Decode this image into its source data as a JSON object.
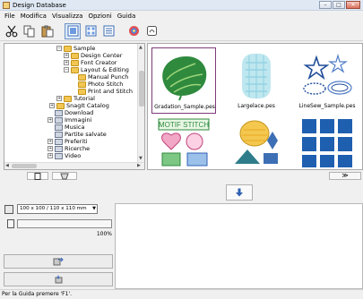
{
  "window": {
    "title": "Design Database"
  },
  "menu": [
    "File",
    "Modifica",
    "Visualizza",
    "Opzioni",
    "Guida"
  ],
  "toolbar": {
    "icons": [
      "cut-icon",
      "copy-icon",
      "paste-icon",
      "large-icons-view-icon",
      "medium-icons-view-icon",
      "small-icons-view-icon",
      "detail-view-icon",
      "property-icon"
    ]
  },
  "tree": {
    "items": [
      {
        "label": "Sample",
        "level": 3,
        "expander": "−"
      },
      {
        "label": "Design Center",
        "level": 4,
        "expander": "+"
      },
      {
        "label": "Font Creator",
        "level": 4,
        "expander": "+"
      },
      {
        "label": "Layout & Editing",
        "level": 4,
        "expander": "−"
      },
      {
        "label": "Manual Punch",
        "level": 5,
        "expander": ""
      },
      {
        "label": "Photo Stitch",
        "level": 5,
        "expander": ""
      },
      {
        "label": "Print and Stitch",
        "level": 5,
        "expander": ""
      },
      {
        "label": "Tutorial",
        "level": 3,
        "expander": "+"
      },
      {
        "label": "SnagIt Catalog",
        "level": 2,
        "expander": "+"
      },
      {
        "label": "Download",
        "level": 1,
        "expander": ""
      },
      {
        "label": "Immagini",
        "level": 1,
        "expander": "+"
      },
      {
        "label": "Musica",
        "level": 1,
        "expander": ""
      },
      {
        "label": "Partite salvate",
        "level": 1,
        "expander": ""
      },
      {
        "label": "Preferiti",
        "level": 1,
        "expander": "+"
      },
      {
        "label": "Ricerche",
        "level": 1,
        "expander": "+"
      },
      {
        "label": "Video",
        "level": 1,
        "expander": "+"
      }
    ]
  },
  "files": [
    {
      "name": "Gradation_Sample.pes",
      "selected": true
    },
    {
      "name": "Largelace.pes",
      "selected": false
    },
    {
      "name": "LineSew_Sample.pes",
      "selected": false
    },
    {
      "name": "",
      "selected": false
    },
    {
      "name": "",
      "selected": false
    },
    {
      "name": "",
      "selected": false
    }
  ],
  "transfer": {
    "icon": "down-arrow-icon"
  },
  "card": {
    "size_option": "100 x 100 / 110 x 110 mm",
    "progress_value": 1.0,
    "progress_text": "100%"
  },
  "statusbar": {
    "text": "Per la Guida premere 'F1'."
  },
  "colors": {
    "accent_selection": "#7d3a79",
    "transfer_arrow": "#2f61b4"
  }
}
